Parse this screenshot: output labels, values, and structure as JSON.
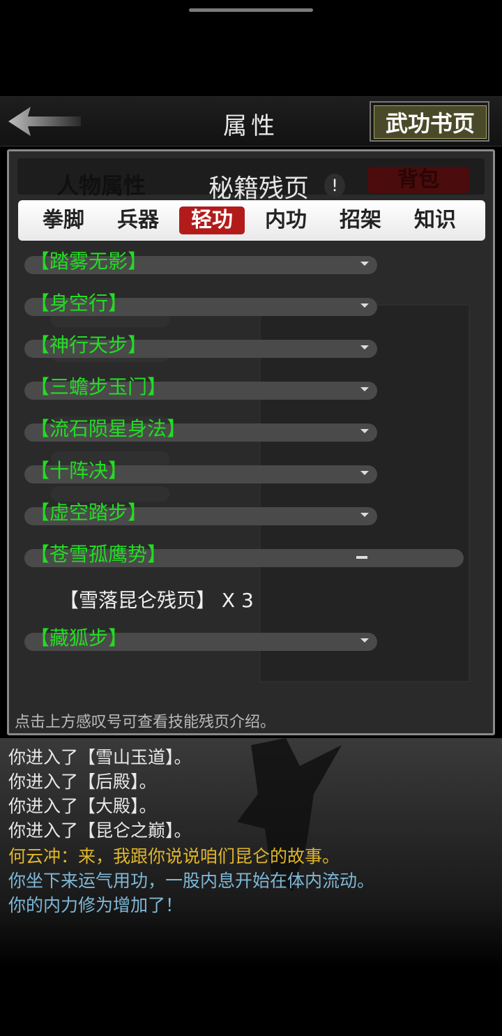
{
  "header": {
    "title": "属性",
    "book_button": "武功书页"
  },
  "panel": {
    "title": "秘籍残页",
    "info_badge": "!",
    "left_tab_ghost": "人物属性",
    "right_tab_ghost": "背包",
    "tabs": [
      "拳脚",
      "兵器",
      "轻功",
      "内功",
      "招架",
      "知识"
    ],
    "active_tab": "轻功",
    "skills": [
      "【踏雾无影】",
      "【身空行】",
      "【神行天步】",
      "【三蟾步玉门】",
      "【流石陨星身法】",
      "【十阵决】",
      "【虚空踏步】",
      "【苍雪孤鹰势】",
      "【藏狐步】"
    ],
    "expanded_item": "【雪落昆仑残页】 X 3",
    "hint": "点击上方感叹号可查看技能残页介绍。"
  },
  "log": [
    {
      "text": "你进入了【雪山玉道】。",
      "color": "white"
    },
    {
      "text": "你进入了【后殿】。",
      "color": "white"
    },
    {
      "text": "你进入了【大殿】。",
      "color": "white"
    },
    {
      "text": "你进入了【昆仑之巅】。",
      "color": "white"
    },
    {
      "text": "何云冲：来，我跟你说说咱们昆仑的故事。",
      "color": "yellow"
    },
    {
      "text": "你坐下来运气用功，一股内息开始在体内流动。",
      "color": "cyan"
    },
    {
      "text": "你的内力修为增加了！",
      "color": "cyan"
    }
  ]
}
